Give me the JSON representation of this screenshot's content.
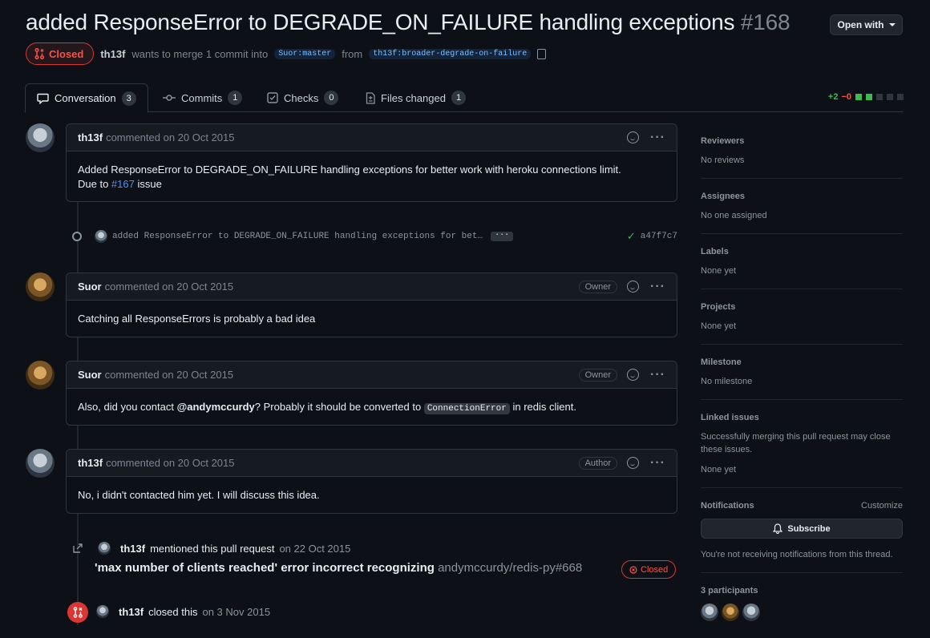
{
  "header": {
    "title": "added ResponseError to DEGRADE_ON_FAILURE handling exceptions",
    "number": "#168",
    "open_with": "Open with",
    "state": "Closed",
    "author": "th13f",
    "merge_text": "wants to merge 1 commit into",
    "base_branch": "Suor:master",
    "from_text": "from",
    "head_branch": "th13f:broader-degrade-on-failure"
  },
  "tabs": [
    {
      "label": "Conversation",
      "count": "3"
    },
    {
      "label": "Commits",
      "count": "1"
    },
    {
      "label": "Checks",
      "count": "0"
    },
    {
      "label": "Files changed",
      "count": "1"
    }
  ],
  "diffstat": {
    "additions": "+2",
    "deletions": "−0"
  },
  "comments": [
    {
      "author": "th13f",
      "action": "commented on 20 Oct 2015",
      "role": "",
      "body_line1": "Added ResponseError to DEGRADE_ON_FAILURE handling exceptions for better work with heroku connections limit.",
      "body_line2_prefix": "Due to ",
      "body_link": "#167",
      "body_line2_suffix": " issue"
    },
    {
      "author": "Suor",
      "action": "commented on 20 Oct 2015",
      "role": "Owner",
      "body": "Catching all ResponseErrors is probably a bad idea"
    },
    {
      "author": "Suor",
      "action": "commented on 20 Oct 2015",
      "role": "Owner",
      "body_prefix": "Also, did you contact ",
      "mention": "@andymccurdy",
      "body_mid": "? Probably it should be converted to ",
      "code": "ConnectionError",
      "body_suffix": " in redis client."
    },
    {
      "author": "th13f",
      "action": "commented on 20 Oct 2015",
      "role": "Author",
      "body": "No, i didn't contacted him yet. I will discuss this idea."
    }
  ],
  "commit": {
    "message": "added ResponseError to DEGRADE_ON_FAILURE handling exceptions for bet…",
    "ellipsis": "···",
    "sha": "a47f7c7"
  },
  "mention_event": {
    "actor": "th13f",
    "text": "mentioned this pull request",
    "date": "on 22 Oct 2015",
    "ref_title": "'max number of clients reached' error incorrect recognizing",
    "ref_repo": "andymccurdy/redis-py#668",
    "ref_state": "Closed"
  },
  "closed_event": {
    "actor": "th13f",
    "text": "closed this",
    "date": "on 3 Nov 2015"
  },
  "sidebar": {
    "reviewers": {
      "title": "Reviewers",
      "value": "No reviews"
    },
    "assignees": {
      "title": "Assignees",
      "value": "No one assigned"
    },
    "labels": {
      "title": "Labels",
      "value": "None yet"
    },
    "projects": {
      "title": "Projects",
      "value": "None yet"
    },
    "milestone": {
      "title": "Milestone",
      "value": "No milestone"
    },
    "linked": {
      "title": "Linked issues",
      "value": "Successfully merging this pull request may close these issues.",
      "value2": "None yet"
    },
    "notifications": {
      "title": "Notifications",
      "customize": "Customize",
      "subscribe": "Subscribe",
      "value": "You're not receiving notifications from this thread."
    },
    "participants": {
      "title": "3 participants"
    }
  },
  "colors": {
    "closed": "#f85149",
    "link": "#4493f8",
    "success": "#3fb950"
  }
}
